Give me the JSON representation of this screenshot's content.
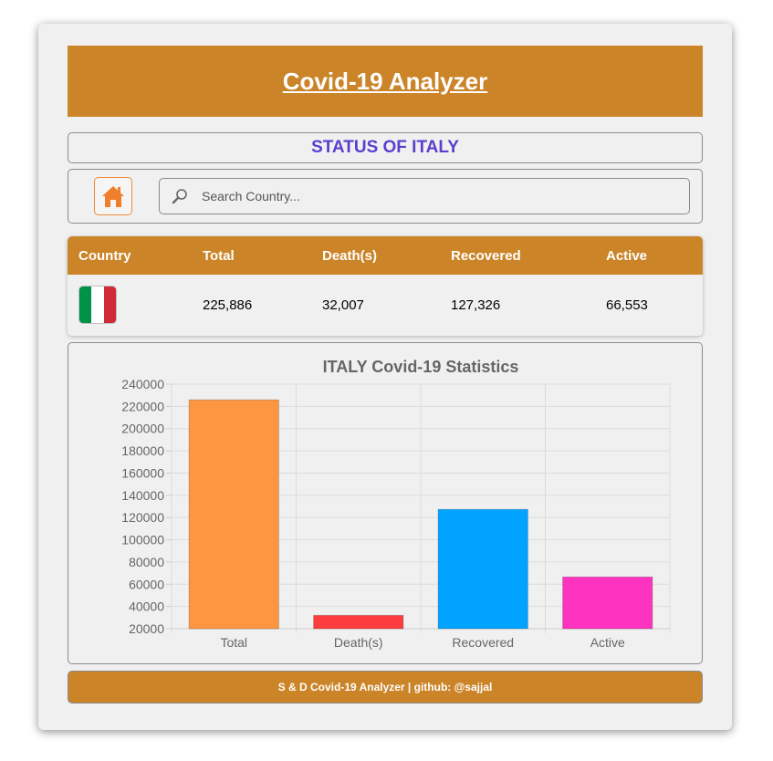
{
  "header": {
    "title": "Covid-19 Analyzer"
  },
  "status": {
    "text": "STATUS OF ITALY"
  },
  "search": {
    "placeholder": "Search Country..."
  },
  "table": {
    "columns": [
      "Country",
      "Total",
      "Death(s)",
      "Recovered",
      "Active"
    ],
    "row": {
      "flag_colors": [
        "#009246",
        "#ffffff",
        "#ce2b37"
      ],
      "total": "225,886",
      "deaths": "32,007",
      "recovered": "127,326",
      "active": "66,553"
    }
  },
  "chart_data": {
    "type": "bar",
    "title": "ITALY Covid-19 Statistics",
    "categories": [
      "Total",
      "Death(s)",
      "Recovered",
      "Active"
    ],
    "values": [
      225886,
      32007,
      127326,
      66553
    ],
    "colors": [
      "#fe9641",
      "#fd3d3d",
      "#00a4ff",
      "#fe33c0"
    ],
    "ylim": [
      20000,
      240000
    ],
    "yticks": [
      "240000",
      "220000",
      "200000",
      "180000",
      "160000",
      "140000",
      "120000",
      "100000",
      "80000",
      "60000",
      "40000",
      "20000"
    ],
    "grid": true
  },
  "footer": {
    "text": "S & D Covid-19 Analyzer | github: @sajjal"
  },
  "colors": {
    "accent": "#cb8428",
    "status_text": "#5b3fd0",
    "home_icon": "#ef7f2a"
  }
}
